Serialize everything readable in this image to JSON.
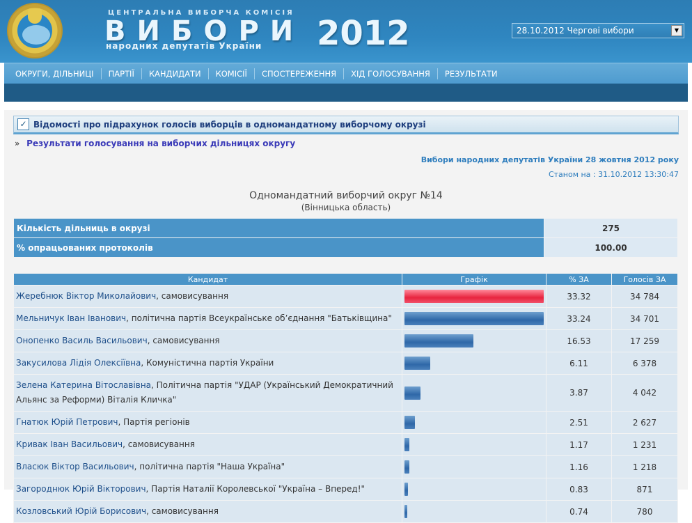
{
  "header": {
    "commission": "ЦЕНТРАЛЬНА ВИБОРЧА КОМІСІЯ",
    "title": "ВИБОРИ",
    "subtitle": "народних депутатів України",
    "year": "2012",
    "election_select": "28.10.2012 Чергові вибори"
  },
  "nav": {
    "items": [
      "ОКРУГИ, ДІЛЬНИЦІ",
      "ПАРТІЇ",
      "КАНДИДАТИ",
      "КОМІСІЇ",
      "СПОСТЕРЕЖЕННЯ",
      "ХІД ГОЛОСУВАННЯ",
      "РЕЗУЛЬТАТИ"
    ]
  },
  "section": {
    "heading": "Відомості про підрахунок голосів виборців в одномандатному виборчому окрузі",
    "sublink": "Результати голосування на виборчих дільницях округу",
    "election_name": "Вибори народних депутатів України 28 жовтня 2012 року",
    "as_of": "Станом на : 31.10.2012 13:30:47",
    "okrug_title": "Одномандатний виборчий округ №14",
    "okrug_region": "(Вінницька область)"
  },
  "summary": [
    {
      "label": "Кількість дільниць в окрузі",
      "value": "275"
    },
    {
      "label": "% опрацьованих протоколів",
      "value": "100.00"
    }
  ],
  "results": {
    "headers": [
      "Кандидат",
      "Графік",
      "% ЗА",
      "Голосів ЗА"
    ],
    "max_pct": 33.32,
    "rows": [
      {
        "name": "Жеребнюк Віктор Миколайович",
        "party": ", самовисування",
        "pct": 33.32,
        "pct_text": "33.32",
        "votes": "34 784",
        "highlight": true
      },
      {
        "name": "Мельничук Іван Іванович",
        "party": ", політична партія Всеукраїнське об’єднання \"Батьківщина\"",
        "pct": 33.24,
        "pct_text": "33.24",
        "votes": "34 701"
      },
      {
        "name": "Онопенко Василь Васильович",
        "party": ", самовисування",
        "pct": 16.53,
        "pct_text": "16.53",
        "votes": "17 259"
      },
      {
        "name": "Закусилова Лідія Олексіївна",
        "party": ", Комуністична партія України",
        "pct": 6.11,
        "pct_text": "6.11",
        "votes": "6 378"
      },
      {
        "name": "Зелена Катерина Вітославівна",
        "party": ", Політична партія \"УДАР (Український Демократичний Альянс за Реформи) Віталія Кличка\"",
        "pct": 3.87,
        "pct_text": "3.87",
        "votes": "4 042"
      },
      {
        "name": "Гнатюк Юрій Петрович",
        "party": ", Партія регіонів",
        "pct": 2.51,
        "pct_text": "2.51",
        "votes": "2 627"
      },
      {
        "name": "Кривак Іван Васильович",
        "party": ", самовисування",
        "pct": 1.17,
        "pct_text": "1.17",
        "votes": "1 231"
      },
      {
        "name": "Власюк Віктор Васильович",
        "party": ", політична партія \"Наша Україна\"",
        "pct": 1.16,
        "pct_text": "1.16",
        "votes": "1 218"
      },
      {
        "name": "Загороднюк Юрій Вікторович",
        "party": ", Партія Наталії Королевської \"Україна – Вперед!\"",
        "pct": 0.83,
        "pct_text": "0.83",
        "votes": "871"
      },
      {
        "name": "Козловський Юрій Борисович",
        "party": ", самовисування",
        "pct": 0.74,
        "pct_text": "0.74",
        "votes": "780"
      }
    ]
  }
}
